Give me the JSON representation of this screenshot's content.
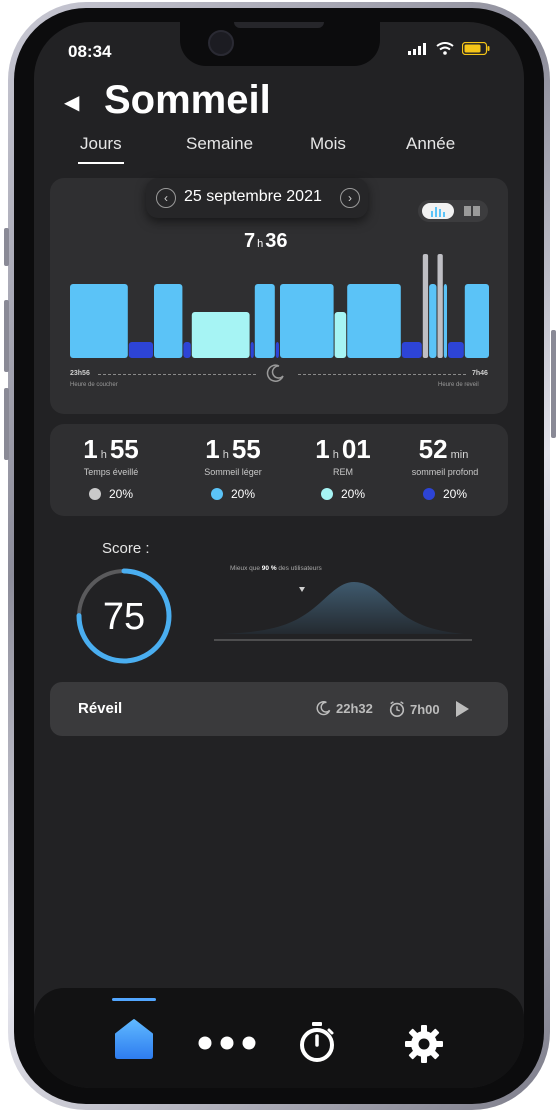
{
  "status_bar": {
    "time": "08:34"
  },
  "header": {
    "title": "Sommeil"
  },
  "tabs": [
    {
      "label": "Jours"
    },
    {
      "label": "Semaine"
    },
    {
      "label": "Mois"
    },
    {
      "label": "Année"
    }
  ],
  "chart": {
    "date": "25 septembre 2021",
    "duration_h": "7",
    "duration_h_unit": "h",
    "duration_m": "36",
    "bedtime": "23h56",
    "bedtime_caption": "Heure de coucher",
    "waketime": "7h46",
    "waketime_caption": "Heure de reveil"
  },
  "chart_data": {
    "type": "bar",
    "title": "",
    "stages": [
      "Éveillé",
      "Sommeil léger",
      "REM",
      "Sommeil profond"
    ],
    "segments": [
      {
        "stage": "Sommeil léger",
        "start": 0.0,
        "end": 0.14
      },
      {
        "stage": "Sommeil profond",
        "start": 0.14,
        "end": 0.2
      },
      {
        "stage": "Sommeil léger",
        "start": 0.2,
        "end": 0.27
      },
      {
        "stage": "Sommeil profond",
        "start": 0.27,
        "end": 0.29
      },
      {
        "stage": "REM",
        "start": 0.29,
        "end": 0.43
      },
      {
        "stage": "Sommeil profond",
        "start": 0.43,
        "end": 0.44
      },
      {
        "stage": "Sommeil léger",
        "start": 0.44,
        "end": 0.49
      },
      {
        "stage": "Sommeil profond",
        "start": 0.49,
        "end": 0.5
      },
      {
        "stage": "Sommeil léger",
        "start": 0.5,
        "end": 0.63
      },
      {
        "stage": "REM",
        "start": 0.63,
        "end": 0.66
      },
      {
        "stage": "Sommeil léger",
        "start": 0.66,
        "end": 0.79
      },
      {
        "stage": "Sommeil profond",
        "start": 0.79,
        "end": 0.84
      },
      {
        "stage": "Éveillé",
        "start": 0.84,
        "end": 0.855
      },
      {
        "stage": "Sommeil léger",
        "start": 0.855,
        "end": 0.875
      },
      {
        "stage": "Éveillé",
        "start": 0.875,
        "end": 0.89
      },
      {
        "stage": "Sommeil léger",
        "start": 0.89,
        "end": 0.9
      },
      {
        "stage": "Sommeil profond",
        "start": 0.9,
        "end": 0.94
      },
      {
        "stage": "Sommeil léger",
        "start": 0.94,
        "end": 1.0
      }
    ],
    "colors": {
      "Éveillé": "#bfbfc4",
      "Sommeil léger": "#5bc3f7",
      "REM": "#a6f4f4",
      "Sommeil profond": "#2d44d6"
    }
  },
  "stats": [
    {
      "value_a": "1",
      "unit": "h",
      "value_b": "55",
      "label": "Temps éveillé",
      "pct": "20%",
      "color": "#c9c9c9"
    },
    {
      "value_a": "1",
      "unit": "h",
      "value_b": "55",
      "label": "Sommeil léger",
      "pct": "20%",
      "color": "#5bc3f7"
    },
    {
      "value_a": "1",
      "unit": "h",
      "value_b": "01",
      "label": "REM",
      "pct": "20%",
      "color": "#a6f4f4"
    },
    {
      "value_a": "52",
      "unit": "min",
      "value_b": "",
      "label": "sommeil profond",
      "pct": "20%",
      "color": "#2d44d6"
    }
  ],
  "score": {
    "label": "Score :",
    "value": "75",
    "fraction": 0.75,
    "ring_color": "#4aaef0",
    "comparison_prefix": "Mieux que ",
    "comparison_value": "90 %",
    "comparison_suffix": " des utilisateurs"
  },
  "reveil": {
    "title": "Réveil",
    "bedtime": "22h32",
    "alarm": "7h00"
  },
  "nav": {
    "items": [
      "home-icon",
      "more-icon",
      "timer-icon",
      "settings-icon"
    ],
    "active_color": "#52a6ff"
  }
}
